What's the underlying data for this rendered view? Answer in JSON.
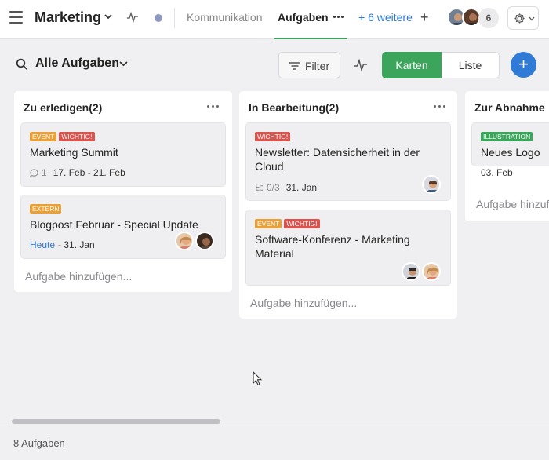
{
  "colors": {
    "green": "#3aa55b",
    "blue": "#2f7bd6",
    "tag_event": "#e8a13a",
    "tag_important": "#d9534f",
    "tag_extern": "#e8a13a",
    "tag_illustration": "#3aa55b",
    "status_dot": "#8e99c2"
  },
  "topbar": {
    "project_title": "Marketing",
    "tabs": {
      "kommunikation": "Kommunikation",
      "aufgaben": "Aufgaben",
      "more": "+ 6 weitere",
      "add": "+"
    },
    "member_count": "6"
  },
  "subheader": {
    "view_title": "Alle Aufgaben",
    "filter_label": "Filter",
    "view_karten": "Karten",
    "view_liste": "Liste",
    "add": "+"
  },
  "columns": [
    {
      "title": "Zu erledigen(2)",
      "add_label": "Aufgabe hinzufügen...",
      "cards": [
        {
          "tags": [
            "EVENT",
            "WICHTIG!"
          ],
          "title": "Marketing Summit",
          "comments": "1",
          "date": "17. Feb - 21. Feb"
        },
        {
          "tags": [
            "EXTERN"
          ],
          "title": "Blogpost Februar - Special Update",
          "date_start": "Heute",
          "date_end": "- 31. Jan"
        }
      ]
    },
    {
      "title": "In Bearbeitung(2)",
      "add_label": "Aufgabe hinzufügen...",
      "cards": [
        {
          "tags": [
            "WICHTIG!"
          ],
          "title_line1": "Newsletter: Datensicherheit in der",
          "title_line2": "Cloud",
          "subtasks": "0/3",
          "date": "31. Jan"
        },
        {
          "tags": [
            "EVENT",
            "WICHTIG!"
          ],
          "title_line1": "Software-Konferenz - Marketing",
          "title_line2": "Material"
        }
      ]
    },
    {
      "title": "Zur Abnahme",
      "add_label": "Aufgabe hinzufügen...",
      "cards": [
        {
          "tags": [
            "ILLUSTRATION"
          ],
          "title": "Neues Logo",
          "date": "03. Feb"
        }
      ]
    }
  ],
  "footer": {
    "task_count": "8 Aufgaben"
  }
}
